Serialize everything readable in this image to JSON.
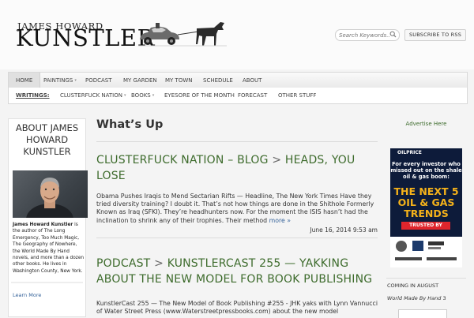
{
  "header": {
    "site_name_top": "JAMES HOWARD",
    "site_name_main": "KUNSTLER",
    "search_placeholder": "Search Keywords...",
    "subscribe_label": "SUBSCRIBE TO RSS"
  },
  "nav_primary": [
    {
      "label": "HOME",
      "has_submenu": false
    },
    {
      "label": "PAINTINGS",
      "has_submenu": true
    },
    {
      "label": "PODCAST",
      "has_submenu": false
    },
    {
      "label": "MY GARDEN",
      "has_submenu": false
    },
    {
      "label": "MY TOWN",
      "has_submenu": false
    },
    {
      "label": "SCHEDULE",
      "has_submenu": false
    },
    {
      "label": "ABOUT",
      "has_submenu": false
    }
  ],
  "nav_secondary": [
    {
      "label": "WRITINGS:",
      "has_submenu": false
    },
    {
      "label": "CLUSTERFUCK NATION",
      "has_submenu": true
    },
    {
      "label": "BOOKS",
      "has_submenu": true
    },
    {
      "label": "EYESORE OF THE MONTH",
      "has_submenu": false
    },
    {
      "label": "FORECAST",
      "has_submenu": false
    },
    {
      "label": "OTHER STUFF",
      "has_submenu": false
    }
  ],
  "sidebar_left": {
    "title": "ABOUT JAMES HOWARD KUNSTLER",
    "bio_name": "James Howard Kunstler",
    "bio_text": " is the author of The Long Emergency, Too Much Magic, The Geography of Nowhere, the World Made By Hand novels, and more than a dozen other books. He lives in Washington County, New York.",
    "learn_more": "Learn More"
  },
  "main": {
    "page_title": "What’s Up",
    "posts": [
      {
        "category": "CLUSTERFUCK NATION – BLOG",
        "separator": ">",
        "title": "HEADS, YOU LOSE",
        "excerpt": "Obama Pushes Iraqis to Mend Sectarian Rifts — Headline, The New York Times Have they tried diversity training? I doubt it. That’s not how things are done in the Shithole Formerly Known as Iraq (SFKI). They’re headhunters now. For the moment the ISIS hasn’t had the inclination to shrink any of their trophies. Their method",
        "more": "more »",
        "date": "June 16, 2014 9:53 am"
      },
      {
        "category": "PODCAST",
        "separator": ">",
        "title": "KUNSTLERCAST 255 — YAKKING ABOUT THE NEW MODEL FOR BOOK PUBLISHING",
        "excerpt": "KunstlerCast 255 — The New Model of Book Publishing #255 - JHK yaks with Lynn Vannucci of Water Street Press (www.Waterstreetpressbooks.com) about the new model"
      }
    ]
  },
  "sidebar_right": {
    "advertise": "Advertise Here",
    "ad": {
      "brand": "OILPRICE",
      "lead": "For every investor who missed out on the shale oil & gas boom:",
      "headline": "THE NEXT 5 OIL & GAS TRENDS",
      "trusted": "TRUSTED BY"
    },
    "coming_label": "COMING IN AUGUST",
    "book_title": "World Made By Hand",
    "book_number": "3"
  },
  "colors": {
    "link_green": "#3d6b2c",
    "link_blue": "#36639a",
    "ad_navy": "#0d1b3a",
    "ad_gold": "#f5b21a"
  }
}
